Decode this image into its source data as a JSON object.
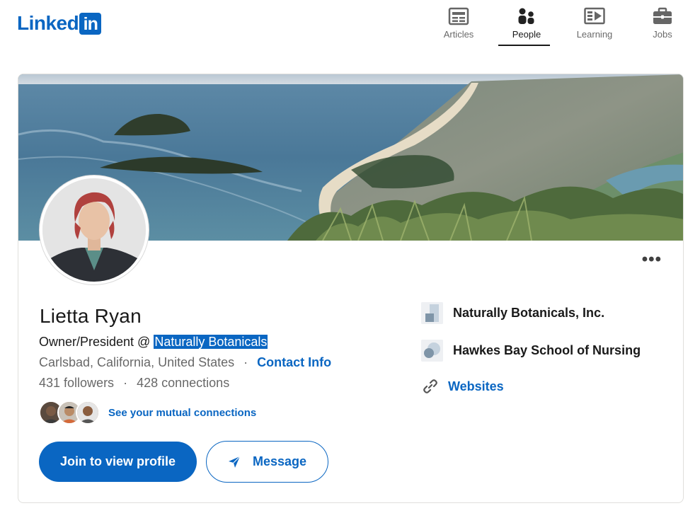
{
  "brand": {
    "logo_text": "Linked",
    "logo_box": "in",
    "color": "#0a66c2"
  },
  "nav": {
    "items": [
      {
        "label": "Articles",
        "icon": "articles-icon"
      },
      {
        "label": "People",
        "icon": "people-icon",
        "active": true
      },
      {
        "label": "Learning",
        "icon": "learning-icon"
      },
      {
        "label": "Jobs",
        "icon": "jobs-icon"
      }
    ]
  },
  "profile": {
    "name": "Lietta Ryan",
    "headline_prefix": "Owner/President @ ",
    "headline_highlight": "Naturally Botanicals",
    "location": "Carlsbad, California, United States",
    "separator": "·",
    "contact_info": "Contact Info",
    "followers": "431 followers",
    "connections": "428 connections",
    "mutual_label": "See your mutual connections",
    "more_label": "•••"
  },
  "actions": {
    "join_label": "Join to view profile",
    "message_label": "Message"
  },
  "sidebar": {
    "current_company": "Naturally Botanicals, Inc.",
    "education": "Hawkes Bay School of Nursing",
    "websites_label": "Websites"
  }
}
